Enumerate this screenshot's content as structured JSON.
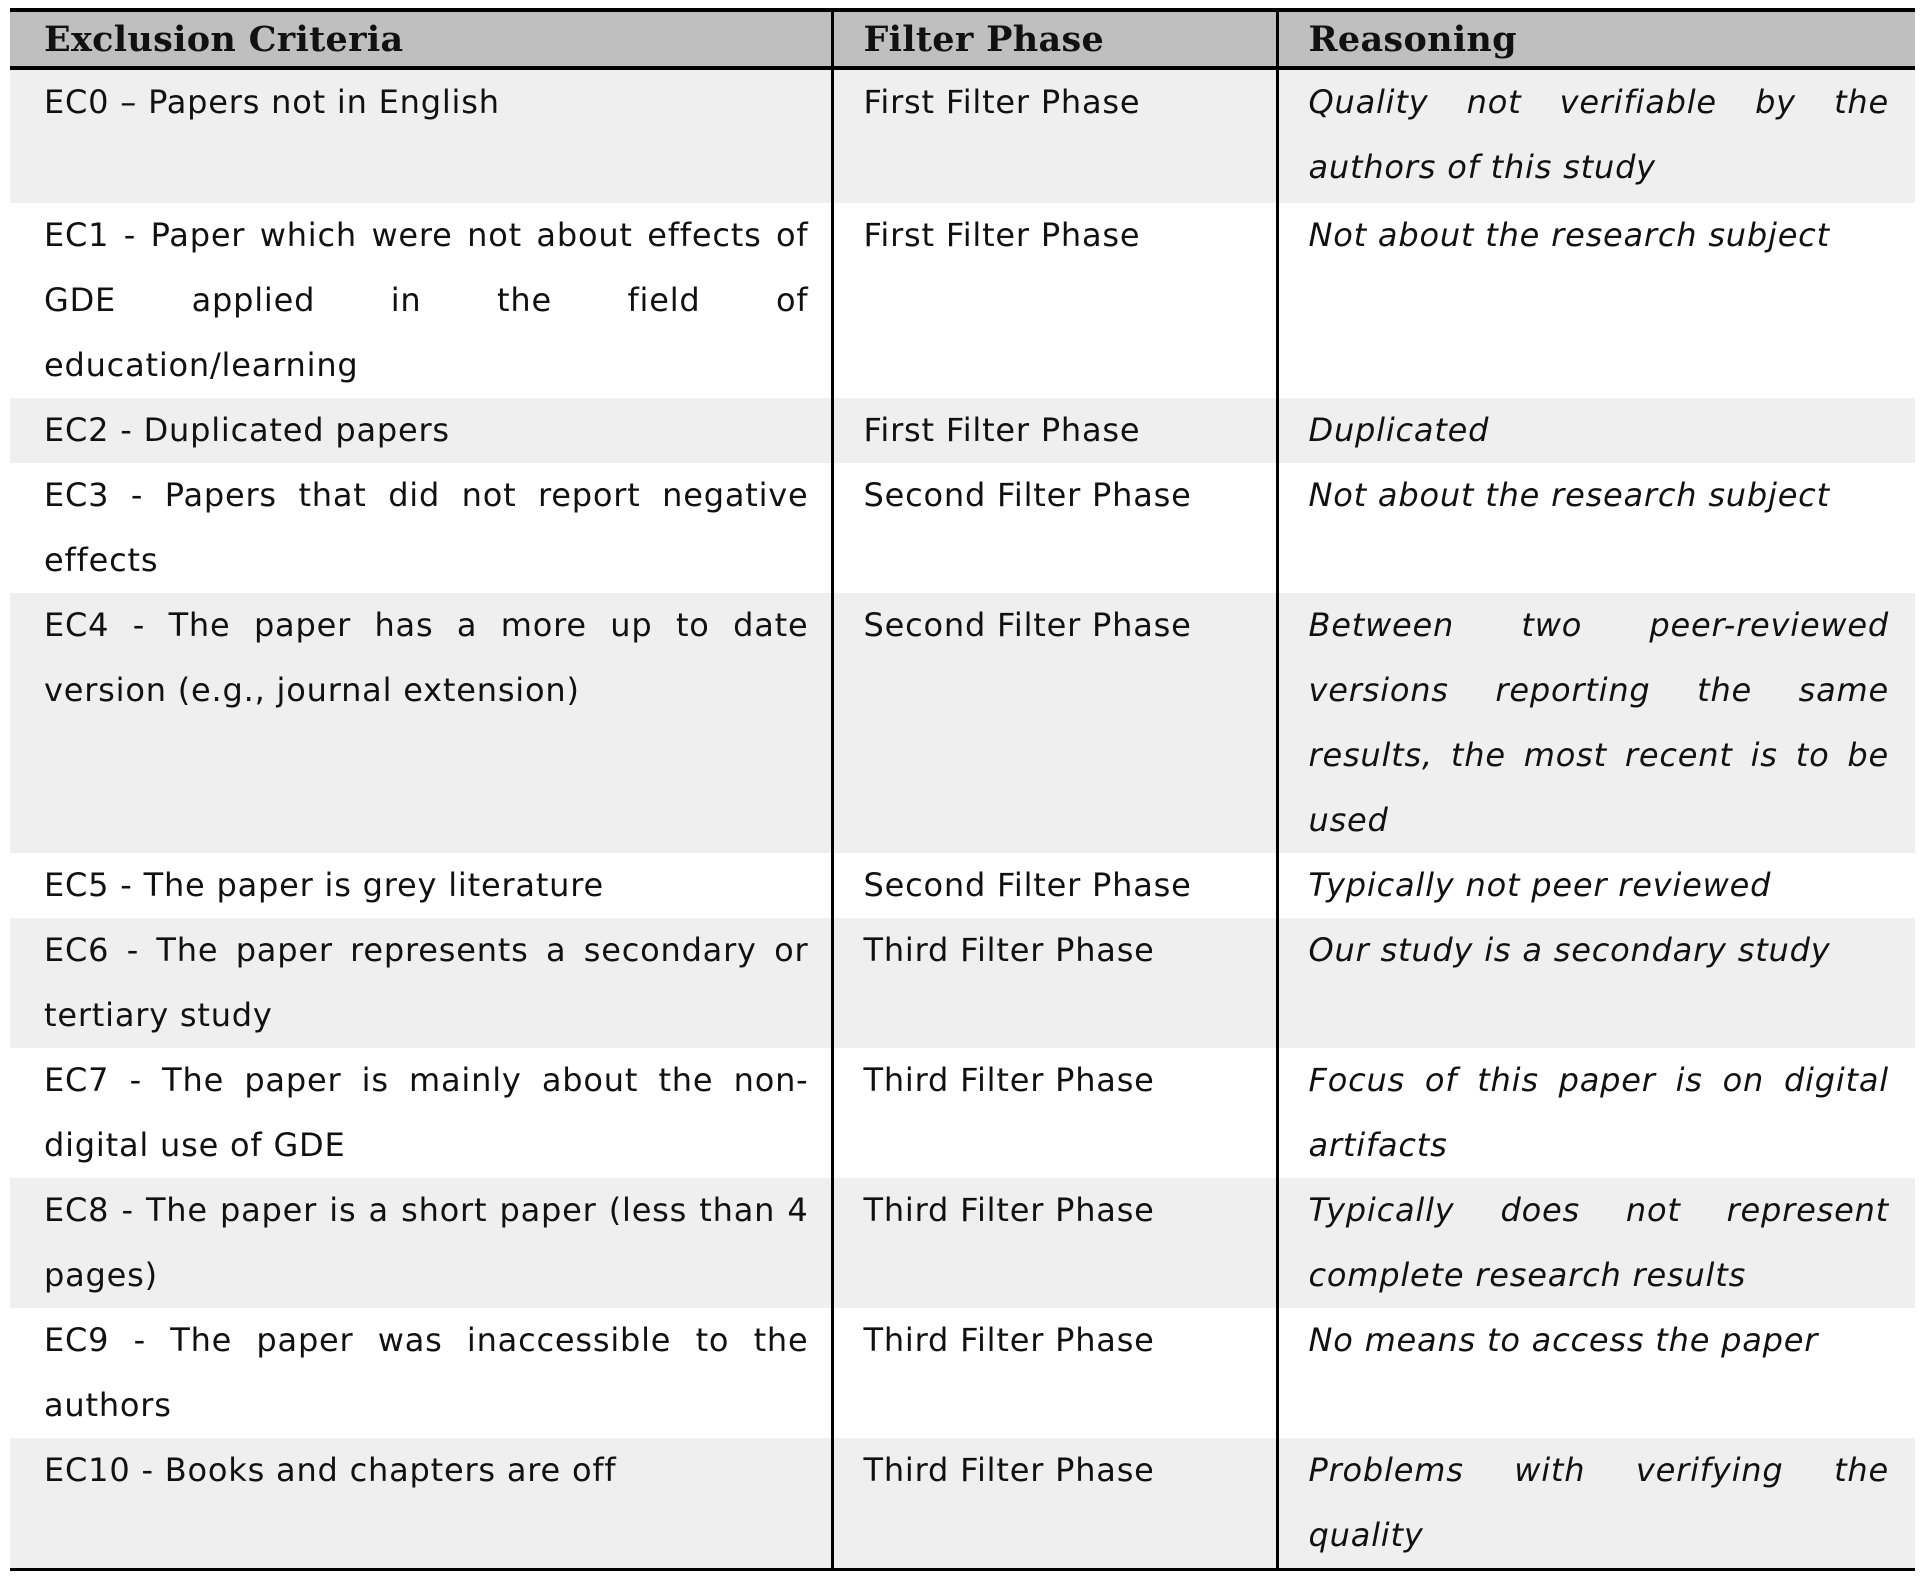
{
  "table": {
    "headers": [
      "Exclusion Criteria",
      "Filter Phase",
      "Reasoning"
    ],
    "rows": [
      {
        "criteria": "EC0 – Papers not in English",
        "phase": "First Filter Phase",
        "reasoning": "Quality not verifiable by the authors of this study",
        "shaded": true
      },
      {
        "criteria": "EC1 - Paper which were not about effects of GDE applied in the field of education/learning",
        "phase": "First Filter Phase",
        "reasoning": "Not about the research subject",
        "shaded": false
      },
      {
        "criteria": "EC2 - Duplicated papers",
        "phase": "First Filter Phase",
        "reasoning": "Duplicated",
        "shaded": true
      },
      {
        "criteria": "EC3 - Papers that did not report negative effects",
        "phase": "Second Filter Phase",
        "reasoning": "Not about the research subject",
        "shaded": false
      },
      {
        "criteria": "EC4 - The paper has a more up to date version (e.g., journal extension)",
        "phase": "Second Filter Phase",
        "reasoning": "Between two peer-reviewed versions reporting the same results, the most recent is to be used",
        "shaded": true
      },
      {
        "criteria": "EC5 - The paper is grey literature",
        "phase": "Second Filter Phase",
        "reasoning": "Typically not peer reviewed",
        "shaded": false
      },
      {
        "criteria": "EC6 - The paper represents a secondary or tertiary study",
        "phase": "Third Filter Phase",
        "reasoning": "Our study is a secondary study",
        "shaded": true
      },
      {
        "criteria": "EC7 - The paper is mainly about the non-digital use of GDE",
        "phase": "Third Filter Phase",
        "reasoning": "Focus of this paper is on digital artifacts",
        "shaded": false
      },
      {
        "criteria": "EC8 - The paper is a short paper (less than 4 pages)",
        "phase": "Third Filter Phase",
        "reasoning": "Typically does not represent complete research results",
        "shaded": true
      },
      {
        "criteria": "EC9 - The paper was inaccessible to the authors",
        "phase": "Third Filter Phase",
        "reasoning": "No means to access the paper",
        "shaded": false
      },
      {
        "criteria": "EC10 - Books and chapters are off",
        "phase": "Third Filter Phase",
        "reasoning": "Problems with verifying the quality",
        "shaded": true
      }
    ]
  },
  "colors": {
    "header_bg": "#bfbfbf",
    "shaded_row_bg": "#efefef",
    "plain_row_bg": "#ffffff",
    "border": "#000000"
  }
}
